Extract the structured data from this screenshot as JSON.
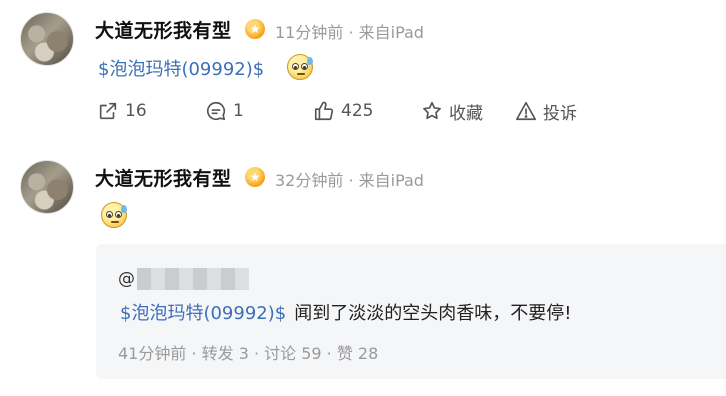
{
  "posts": [
    {
      "username": "大道无形我有型",
      "badge_icon": "vip-badge-icon",
      "meta": "11分钟前 · 来自iPad",
      "stock_tag": "$泡泡玛特(09992)$",
      "emoji": "sweating-smile-emoji",
      "actions": {
        "repost_count": "16",
        "comment_count": "1",
        "like_count": "425",
        "favorite_label": "收藏",
        "report_label": "投诉"
      }
    },
    {
      "username": "大道无形我有型",
      "badge_icon": "vip-badge-icon",
      "meta": "32分钟前 · 来自iPad",
      "emoji": "sweating-smile-emoji",
      "quote": {
        "user_prefix": "@",
        "user_name_obscured": true,
        "stock_tag": "$泡泡玛特(09992)$",
        "text": "闻到了淡淡的空头肉香味，不要停!",
        "meta": "41分钟前 · 转发 3 · 讨论 59 · 赞 28"
      }
    }
  ],
  "colors": {
    "link": "#3d6fb8",
    "meta_gray": "#9a9a9a",
    "quote_bg": "#f5f6f8",
    "badge_gold": "#f4a21a"
  }
}
